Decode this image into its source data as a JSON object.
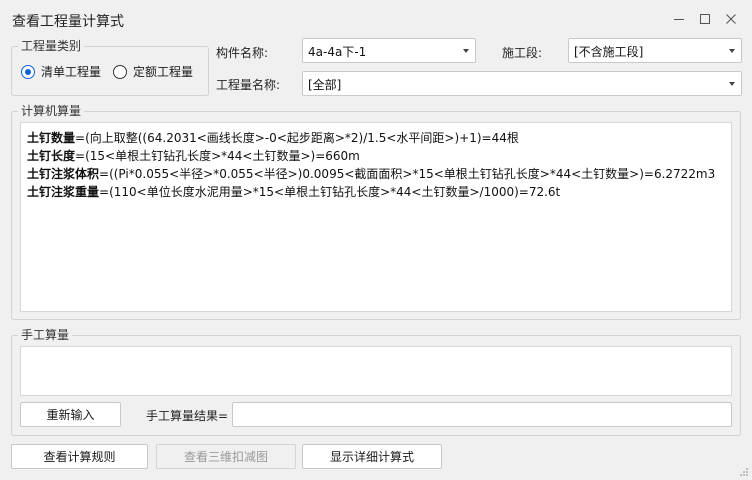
{
  "window": {
    "title": "查看工程量计算式"
  },
  "quantity_type": {
    "legend": "工程量类别",
    "options": [
      "清单工程量",
      "定额工程量"
    ],
    "selected": 0
  },
  "component": {
    "label": "构件名称:",
    "value": "4a-4a下-1"
  },
  "stage": {
    "label": "施工段:",
    "value": "[不含施工段]"
  },
  "quantity_name": {
    "label": "工程量名称:",
    "value": "[全部]"
  },
  "computer_calc": {
    "legend": "计算机算量",
    "lines": [
      {
        "name": "土钉数量",
        "formula": "=(向上取整((64.2031<画线长度>-0<起步距离>*2)/1.5<水平间距>)+1)=44根"
      },
      {
        "name": "土钉长度",
        "formula": "=(15<单根土钉钻孔长度>*44<土钉数量>)=660m"
      },
      {
        "name": "土钉注浆体积",
        "formula": "=((Pi*0.055<半径>*0.055<半径>)0.0095<截面面积>*15<单根土钉钻孔长度>*44<土钉数量>)=6.2722m3"
      },
      {
        "name": "土钉注浆重量",
        "formula": "=(110<单位长度水泥用量>*15<单根土钉钻孔长度>*44<土钉数量>/1000)=72.6t"
      }
    ]
  },
  "manual_calc": {
    "legend": "手工算量",
    "reenter_label": "重新输入",
    "result_label": "手工算量结果=",
    "result_value": ""
  },
  "footer": {
    "rules_label": "查看计算规则",
    "view3d_label": "查看三维扣减图",
    "detail_label": "显示详细计算式"
  }
}
